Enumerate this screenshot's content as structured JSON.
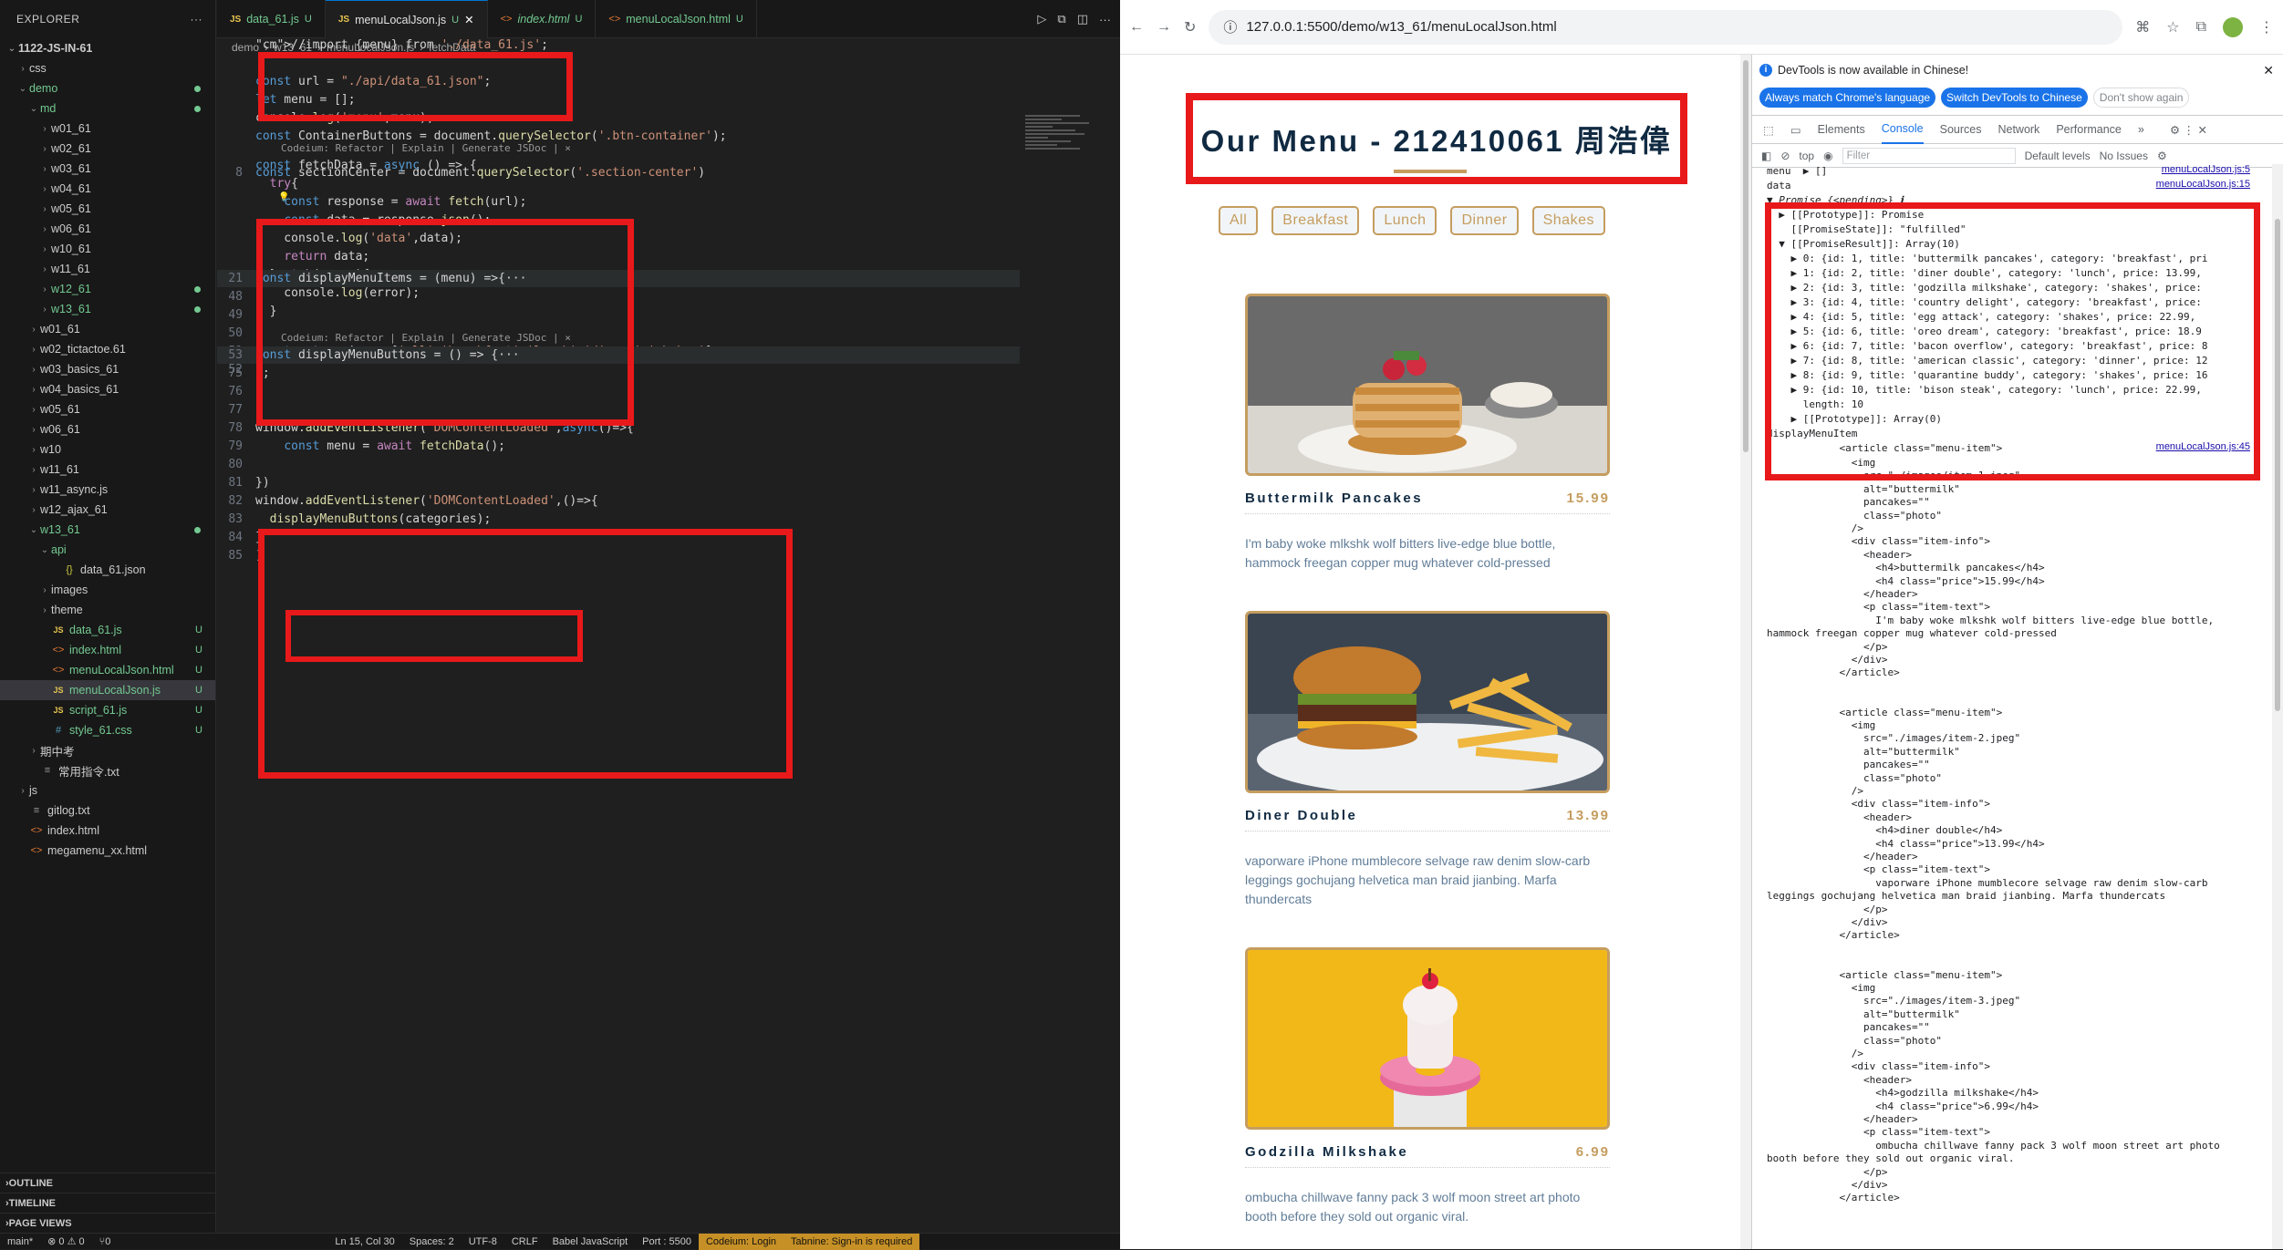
{
  "explorer": {
    "title": "EXPLORER",
    "root": "1122-JS-IN-61",
    "items": [
      {
        "label": "css",
        "indent": 1,
        "chev": "›",
        "icon": "",
        "badge": "",
        "color": ""
      },
      {
        "label": "demo",
        "indent": 1,
        "chev": "⌄",
        "icon": "",
        "badge": "dot",
        "color": "green"
      },
      {
        "label": "md",
        "indent": 2,
        "chev": "⌄",
        "icon": "",
        "badge": "dot",
        "color": "green"
      },
      {
        "label": "w01_61",
        "indent": 3,
        "chev": "›",
        "icon": "",
        "badge": "",
        "color": ""
      },
      {
        "label": "w02_61",
        "indent": 3,
        "chev": "›",
        "icon": "",
        "badge": "",
        "color": ""
      },
      {
        "label": "w03_61",
        "indent": 3,
        "chev": "›",
        "icon": "",
        "badge": "",
        "color": ""
      },
      {
        "label": "w04_61",
        "indent": 3,
        "chev": "›",
        "icon": "",
        "badge": "",
        "color": ""
      },
      {
        "label": "w05_61",
        "indent": 3,
        "chev": "›",
        "icon": "",
        "badge": "",
        "color": ""
      },
      {
        "label": "w06_61",
        "indent": 3,
        "chev": "›",
        "icon": "",
        "badge": "",
        "color": ""
      },
      {
        "label": "w10_61",
        "indent": 3,
        "chev": "›",
        "icon": "",
        "badge": "",
        "color": ""
      },
      {
        "label": "w11_61",
        "indent": 3,
        "chev": "›",
        "icon": "",
        "badge": "",
        "color": ""
      },
      {
        "label": "w12_61",
        "indent": 3,
        "chev": "›",
        "icon": "",
        "badge": "dot",
        "color": "green"
      },
      {
        "label": "w13_61",
        "indent": 3,
        "chev": "›",
        "icon": "",
        "badge": "dot",
        "color": "green"
      },
      {
        "label": "w01_61",
        "indent": 2,
        "chev": "›",
        "icon": "",
        "badge": "",
        "color": ""
      },
      {
        "label": "w02_tictactoe.61",
        "indent": 2,
        "chev": "›",
        "icon": "",
        "badge": "",
        "color": ""
      },
      {
        "label": "w03_basics_61",
        "indent": 2,
        "chev": "›",
        "icon": "",
        "badge": "",
        "color": ""
      },
      {
        "label": "w04_basics_61",
        "indent": 2,
        "chev": "›",
        "icon": "",
        "badge": "",
        "color": ""
      },
      {
        "label": "w05_61",
        "indent": 2,
        "chev": "›",
        "icon": "",
        "badge": "",
        "color": ""
      },
      {
        "label": "w06_61",
        "indent": 2,
        "chev": "›",
        "icon": "",
        "badge": "",
        "color": ""
      },
      {
        "label": "w10",
        "indent": 2,
        "chev": "›",
        "icon": "",
        "badge": "",
        "color": ""
      },
      {
        "label": "w11_61",
        "indent": 2,
        "chev": "›",
        "icon": "",
        "badge": "",
        "color": ""
      },
      {
        "label": "w11_async.js",
        "indent": 2,
        "chev": "›",
        "icon": "",
        "badge": "",
        "color": ""
      },
      {
        "label": "w12_ajax_61",
        "indent": 2,
        "chev": "›",
        "icon": "",
        "badge": "",
        "color": ""
      },
      {
        "label": "w13_61",
        "indent": 2,
        "chev": "⌄",
        "icon": "",
        "badge": "dot",
        "color": "green"
      },
      {
        "label": "api",
        "indent": 3,
        "chev": "⌄",
        "icon": "",
        "badge": "",
        "color": "green"
      },
      {
        "label": "data_61.json",
        "indent": 4,
        "chev": "",
        "icon": "{}",
        "badge": "",
        "color": "json"
      },
      {
        "label": "images",
        "indent": 3,
        "chev": "›",
        "icon": "",
        "badge": "",
        "color": ""
      },
      {
        "label": "theme",
        "indent": 3,
        "chev": "›",
        "icon": "",
        "badge": "",
        "color": ""
      },
      {
        "label": "data_61.js",
        "indent": 3,
        "chev": "",
        "icon": "JS",
        "badge": "U",
        "color": "green"
      },
      {
        "label": "index.html",
        "indent": 3,
        "chev": "",
        "icon": "<>",
        "badge": "U",
        "color": "green"
      },
      {
        "label": "menuLocalJson.html",
        "indent": 3,
        "chev": "",
        "icon": "<>",
        "badge": "U",
        "color": "green"
      },
      {
        "label": "menuLocalJson.js",
        "indent": 3,
        "chev": "",
        "icon": "JS",
        "badge": "U",
        "color": "green",
        "selected": true
      },
      {
        "label": "script_61.js",
        "indent": 3,
        "chev": "",
        "icon": "JS",
        "badge": "U",
        "color": "green"
      },
      {
        "label": "style_61.css",
        "indent": 3,
        "chev": "",
        "icon": "#",
        "badge": "U",
        "color": "green"
      },
      {
        "label": "期中考",
        "indent": 2,
        "chev": "›",
        "icon": "",
        "badge": "",
        "color": ""
      },
      {
        "label": "常用指令.txt",
        "indent": 2,
        "chev": "",
        "icon": "≡",
        "badge": "",
        "color": ""
      },
      {
        "label": "js",
        "indent": 1,
        "chev": "›",
        "icon": "",
        "badge": "",
        "color": ""
      },
      {
        "label": "gitlog.txt",
        "indent": 1,
        "chev": "",
        "icon": "≡",
        "badge": "",
        "color": ""
      },
      {
        "label": "index.html",
        "indent": 1,
        "chev": "",
        "icon": "<>",
        "badge": "",
        "color": ""
      },
      {
        "label": "megamenu_xx.html",
        "indent": 1,
        "chev": "",
        "icon": "<>",
        "badge": "",
        "color": ""
      }
    ],
    "bottom": [
      "OUTLINE",
      "TIMELINE",
      "PAGE VIEWS"
    ]
  },
  "tabs": [
    {
      "label": "data_61.js",
      "type": "js",
      "badge": "U",
      "active": false
    },
    {
      "label": "menuLocalJson.js",
      "type": "js",
      "badge": "U",
      "active": true
    },
    {
      "label": "index.html",
      "type": "html",
      "badge": "U",
      "active": false
    },
    {
      "label": "menuLocalJson.html",
      "type": "html",
      "badge": "U",
      "active": false
    }
  ],
  "breadcrumb": [
    "demo",
    "w13_61",
    "menuLocalJson.js",
    "fetchData"
  ],
  "code_lines": [
    {
      "n": "",
      "t": "//import {menu} from './data_61.js';"
    },
    {
      "n": "",
      "t": ""
    },
    {
      "n": "",
      "t": "const url = \"./api/data_61.json\";"
    },
    {
      "n": "",
      "t": "let menu = [];"
    },
    {
      "n": "",
      "t": "console.log('menu',menu);"
    },
    {
      "n": "",
      "t": "const ContainerButtons = document.querySelector('.btn-container');"
    },
    {
      "n": "",
      "t": ""
    },
    {
      "n": "8",
      "t": "const sectionCenter = document.querySelector('.section-center')"
    }
  ],
  "codeium_lens": "Codeium: Refactor | Explain | Generate JSDoc | ×",
  "fetch_lines": [
    {
      "n": "",
      "t": "const fetchData = async () => {"
    },
    {
      "n": "",
      "t": "  try{"
    },
    {
      "n": "",
      "t": "    const response = await fetch(url);"
    },
    {
      "n": "",
      "t": "    const data = response.json();"
    },
    {
      "n": "",
      "t": "    console.log('data',data);"
    },
    {
      "n": "",
      "t": "    return data;"
    },
    {
      "n": "",
      "t": "  }catch(error){"
    },
    {
      "n": "",
      "t": "    console.log(error);"
    },
    {
      "n": "",
      "t": "  }"
    },
    {
      "n": "",
      "t": "}"
    }
  ],
  "mid_lines": [
    {
      "n": "21",
      "t": "const displayMenuItems = (menu) =>{···"
    },
    {
      "n": "48",
      "t": "}"
    },
    {
      "n": "49",
      "t": ""
    },
    {
      "n": "50",
      "t": ""
    },
    {
      "n": "51",
      "t": "const categories = ['all','breakfast','lunch','dinner','shakes']"
    },
    {
      "n": "52",
      "t": ""
    }
  ],
  "bottom_lines": [
    {
      "n": "53",
      "t": "const displayMenuButtons = () => {···"
    },
    {
      "n": "75",
      "t": "};"
    },
    {
      "n": "76",
      "t": ""
    },
    {
      "n": "77",
      "t": ""
    },
    {
      "n": "78",
      "t": "window.addEventListener('DOMContentLoaded',async()=>{"
    },
    {
      "n": "79",
      "t": "    const menu = await fetchData();"
    },
    {
      "n": "80",
      "t": ""
    },
    {
      "n": "81",
      "t": "})"
    },
    {
      "n": "82",
      "t": "window.addEventListener('DOMContentLoaded',()=>{"
    },
    {
      "n": "83",
      "t": "  displayMenuButtons(categories);"
    },
    {
      "n": "84",
      "t": "}"
    },
    {
      "n": "85",
      "t": ")"
    }
  ],
  "statusbar": {
    "branch": "main*",
    "errors": "⊗ 0 ⚠ 0",
    "ports": "⑂0",
    "position": "Ln 15, Col 30",
    "spaces": "Spaces: 2",
    "encoding": "UTF-8",
    "eol": "CRLF",
    "language": "Babel JavaScript",
    "port": "Port : 5500",
    "codeium": "Codeium: Login",
    "tabnine": "Tabnine: Sign-in is required"
  },
  "browser": {
    "url": "127.0.0.1:5500/demo/w13_61/menuLocalJson.html"
  },
  "page": {
    "title": "Our Menu - 212410061 周浩偉",
    "buttons": [
      "All",
      "Breakfast",
      "Lunch",
      "Dinner",
      "Shakes"
    ],
    "items": [
      {
        "name": "Buttermilk Pancakes",
        "price": "15.99",
        "text": "I'm baby woke mlkshk wolf bitters live-edge blue bottle, hammock freegan copper mug whatever cold-pressed"
      },
      {
        "name": "Diner Double",
        "price": "13.99",
        "text": "vaporware iPhone mumblecore selvage raw denim slow-carb leggings gochujang helvetica man braid jianbing. Marfa thundercats"
      },
      {
        "name": "Godzilla Milkshake",
        "price": "6.99",
        "text": "ombucha chillwave fanny pack 3 wolf moon street art photo booth before they sold out organic viral."
      }
    ]
  },
  "devtools": {
    "notice": "DevTools is now available in Chinese!",
    "btn1": "Always match Chrome's language",
    "btn2": "Switch DevTools to Chinese",
    "btn3": "Don't show again",
    "tabs": [
      "Elements",
      "Console",
      "Sources",
      "Network",
      "Performance",
      "»"
    ],
    "active_tab": "Console",
    "context": "top",
    "filter_placeholder": "Filter",
    "levels": "Default levels",
    "issues": "No Issues",
    "src1": "menuLocalJson.js:5",
    "src2": "menuLocalJson.js:15",
    "src3": "menuLocalJson.js:45",
    "console_lines": [
      "menu  ▶ []",
      "data",
      "▼ Promise {<pending>} ℹ",
      "  ▶ [[Prototype]]: Promise",
      "    [[PromiseState]]: \"fulfilled\"",
      "  ▼ [[PromiseResult]]: Array(10)",
      "    ▶ 0: {id: 1, title: 'buttermilk pancakes', category: 'breakfast', pri",
      "    ▶ 1: {id: 2, title: 'diner double', category: 'lunch', price: 13.99,",
      "    ▶ 2: {id: 3, title: 'godzilla milkshake', category: 'shakes', price:",
      "    ▶ 3: {id: 4, title: 'country delight', category: 'breakfast', price:",
      "    ▶ 4: {id: 5, title: 'egg attack', category: 'shakes', price: 22.99,",
      "    ▶ 5: {id: 6, title: 'oreo dream', category: 'breakfast', price: 18.9",
      "    ▶ 6: {id: 7, title: 'bacon overflow', category: 'breakfast', price: 8",
      "    ▶ 7: {id: 8, title: 'american classic', category: 'dinner', price: 12",
      "    ▶ 8: {id: 9, title: 'quarantine buddy', category: 'shakes', price: 16",
      "    ▶ 9: {id: 10, title: 'bison steak', category: 'lunch', price: 22.99,",
      "      length: 10",
      "    ▶ [[Prototype]]: Array(0)",
      "displayMenuItem",
      "            <article class=\"menu-item\">"
    ],
    "html_lines": [
      "              <img",
      "                src=\"./images/item-1.jpeg\"",
      "                alt=\"buttermilk\"",
      "                pancakes=\"\"",
      "                class=\"photo\"",
      "              />",
      "              <div class=\"item-info\">",
      "                <header>",
      "                  <h4>buttermilk pancakes</h4>",
      "                  <h4 class=\"price\">15.99</h4>",
      "                </header>",
      "                <p class=\"item-text\">",
      "                  I'm baby woke mlkshk wolf bitters live-edge blue bottle,",
      "hammock freegan copper mug whatever cold-pressed",
      "                </p>",
      "              </div>",
      "            </article>",
      "",
      "",
      "            <article class=\"menu-item\">",
      "              <img",
      "                src=\"./images/item-2.jpeg\"",
      "                alt=\"buttermilk\"",
      "                pancakes=\"\"",
      "                class=\"photo\"",
      "              />",
      "              <div class=\"item-info\">",
      "                <header>",
      "                  <h4>diner double</h4>",
      "                  <h4 class=\"price\">13.99</h4>",
      "                </header>",
      "                <p class=\"item-text\">",
      "                  vaporware iPhone mumblecore selvage raw denim slow-carb",
      "leggings gochujang helvetica man braid jianbing. Marfa thundercats",
      "                </p>",
      "              </div>",
      "            </article>",
      "",
      "",
      "            <article class=\"menu-item\">",
      "              <img",
      "                src=\"./images/item-3.jpeg\"",
      "                alt=\"buttermilk\"",
      "                pancakes=\"\"",
      "                class=\"photo\"",
      "              />",
      "              <div class=\"item-info\">",
      "                <header>",
      "                  <h4>godzilla milkshake</h4>",
      "                  <h4 class=\"price\">6.99</h4>",
      "                </header>",
      "                <p class=\"item-text\">",
      "                  ombucha chillwave fanny pack 3 wolf moon street art photo",
      "booth before they sold out organic viral.",
      "                </p>",
      "              </div>",
      "            </article>"
    ]
  },
  "colors": {
    "accent": "#c59d5f",
    "title": "#102a42",
    "annotation": "#e8191a",
    "vscode_bg": "#1f1f1f"
  }
}
